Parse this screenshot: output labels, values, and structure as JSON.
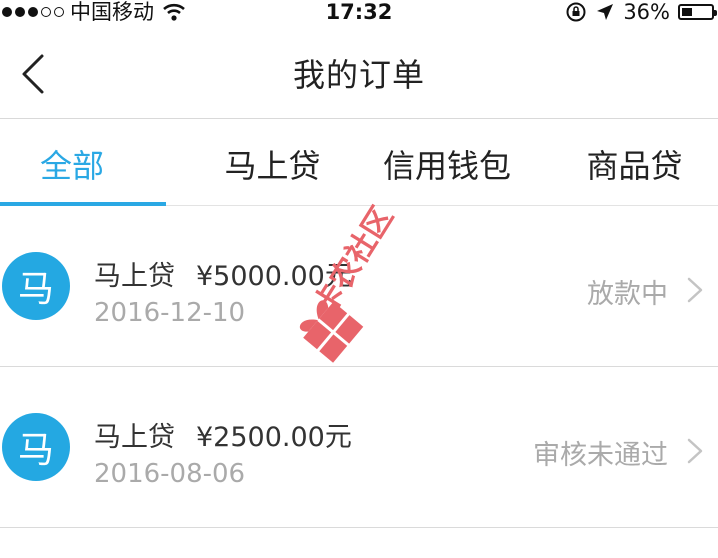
{
  "status_bar": {
    "carrier": "中国移动",
    "time": "17:32",
    "battery": "36%",
    "battery_level": 0.36
  },
  "nav": {
    "title": "我的订单",
    "back_icon": "chevron-left-icon"
  },
  "tabs": [
    {
      "label": "全部",
      "active": true
    },
    {
      "label": "马上贷",
      "active": false
    },
    {
      "label": "信用钱包",
      "active": false
    },
    {
      "label": "商品贷",
      "active": false
    }
  ],
  "orders": [
    {
      "avatar": "马",
      "name": "马上贷",
      "amount": "¥5000.00元",
      "date": "2016-12-10",
      "status": "放款中"
    },
    {
      "avatar": "马",
      "name": "马上贷",
      "amount": "¥2500.00元",
      "date": "2016-08-06",
      "status": "审核未通过"
    }
  ],
  "watermark": {
    "text": "卡农社区"
  },
  "colors": {
    "accent": "#2aa8e4",
    "avatar_bg": "#24a8e2",
    "muted_text": "#aaaaaa",
    "watermark": "#e8646a"
  }
}
